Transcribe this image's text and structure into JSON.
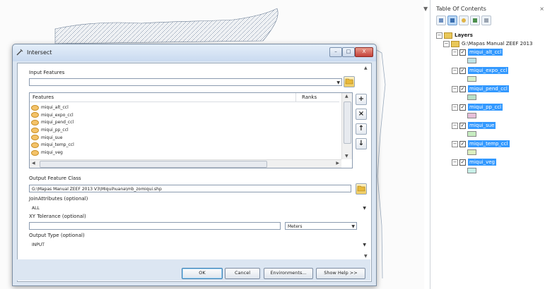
{
  "dialog": {
    "title": "Intersect",
    "window_buttons": {
      "minimize": "–",
      "maximize": "□",
      "close": "X"
    },
    "input_features": {
      "label": "Input Features",
      "value": ""
    },
    "features_table": {
      "col_features": "Features",
      "col_ranks": "Ranks",
      "rows": [
        "miqui_alt_ccl",
        "miqui_expo_ccl",
        "miqui_pend_ccl",
        "miqui_pp_ccl",
        "miqui_sue",
        "miqui_temp_ccl",
        "miqui_veg"
      ]
    },
    "side_buttons": {
      "add": "+",
      "remove": "×",
      "up": "↑",
      "down": "↓"
    },
    "output_feature_class": {
      "label": "Output Feature Class",
      "value": "G:\\Mapas Manual ZEEF 2013 V3\\Miquihuana\\mb_zomiqui.shp"
    },
    "join_attributes": {
      "label": "JoinAttributes (optional)",
      "value": "ALL"
    },
    "xy_tolerance": {
      "label": "XY Tolerance (optional)",
      "value": "",
      "unit": "Meters"
    },
    "output_type": {
      "label": "Output Type (optional)",
      "value": "INPUT"
    },
    "buttons": {
      "ok": "OK",
      "cancel": "Cancel",
      "environments": "Environments...",
      "show_help": "Show Help >>"
    }
  },
  "toc": {
    "title": "Table Of Contents",
    "pin": "▼",
    "close": "×",
    "layers_root": "Layers",
    "folder": "G:\\Mapas  Manual ZEEF 2013",
    "layers": [
      {
        "name": "miqui_alt_ccl",
        "color": "#bfe3e6"
      },
      {
        "name": "miqui_expo_ccl",
        "color": "#d7efc9"
      },
      {
        "name": "miqui_pend_ccl",
        "color": "#b8e0c6"
      },
      {
        "name": "miqui_pp_ccl",
        "color": "#e6bfd9"
      },
      {
        "name": "miqui_sue",
        "color": "#c6ecc0"
      },
      {
        "name": "miqui_temp_ccl",
        "color": "#dcefbf"
      },
      {
        "name": "miqui_veg",
        "color": "#c8f0e8"
      }
    ]
  }
}
